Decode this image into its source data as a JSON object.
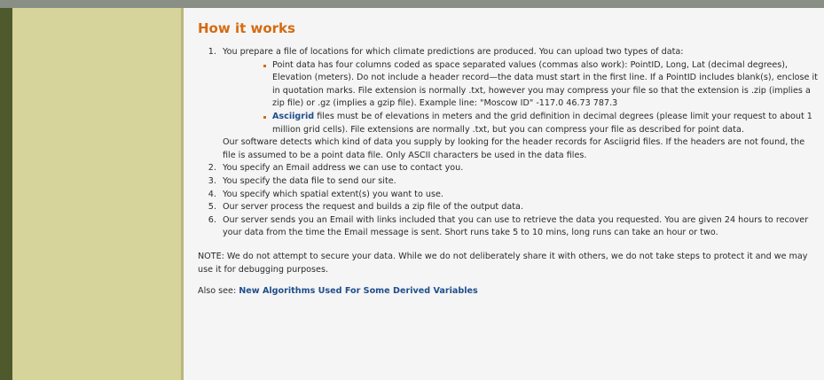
{
  "page": {
    "heading": "How it works",
    "steps": [
      "You prepare a file of locations for which climate predictions are produced. You can upload two types of data:",
      "You specify an Email address we can use to contact you.",
      "You specify the data file to send our site.",
      "You specify which spatial extent(s) you want to use.",
      "Our server process the request and builds a zip file of the output data.",
      "Our server sends you an Email with links included that you can use to retrieve the data you requested. You are given 24 hours to recover your data from the time the Email message is sent. Short runs take 5 to 10 mins, long runs can take an hour or two."
    ],
    "point_data_text": "Point data has four columns coded as space separated values (commas also work): PointID, Long, Lat (decimal degrees), Elevation (meters). Do not include a header record—the data must start in the first line. If a PointID includes blank(s), enclose it in quotation marks. File extension is normally .txt, however you may compress your file so that the extension is .zip (implies a zip file) or .gz (implies a gzip file). Example line: \"Moscow ID\" -117.0 46.73 787.3",
    "asciigrid_link": "Asciigrid",
    "asciigrid_text": " files must be of elevations in meters and the grid definition in decimal degrees (please limit your request to about 1 million grid cells). File extensions are normally .txt, but you can compress your file as described for point data.",
    "detect_text": "Our software detects which kind of data you supply by looking for the header records for Asciigrid files. If the headers are not found, the file is assumed to be a point data file. Only ASCII characters be used in the data files.",
    "note": "NOTE: We do not attempt to secure your data. While we do not deliberately share it with others, we do not take steps to protect it and we may use it for debugging purposes.",
    "also_see_label": "Also see: ",
    "also_see_link": "New Algorithms Used For Some Derived Variables"
  },
  "colors": {
    "heading": "#d46b12",
    "link": "#1f4e8c",
    "sidebar": "#d6d49b",
    "left_stripe": "#4f5a2c"
  }
}
